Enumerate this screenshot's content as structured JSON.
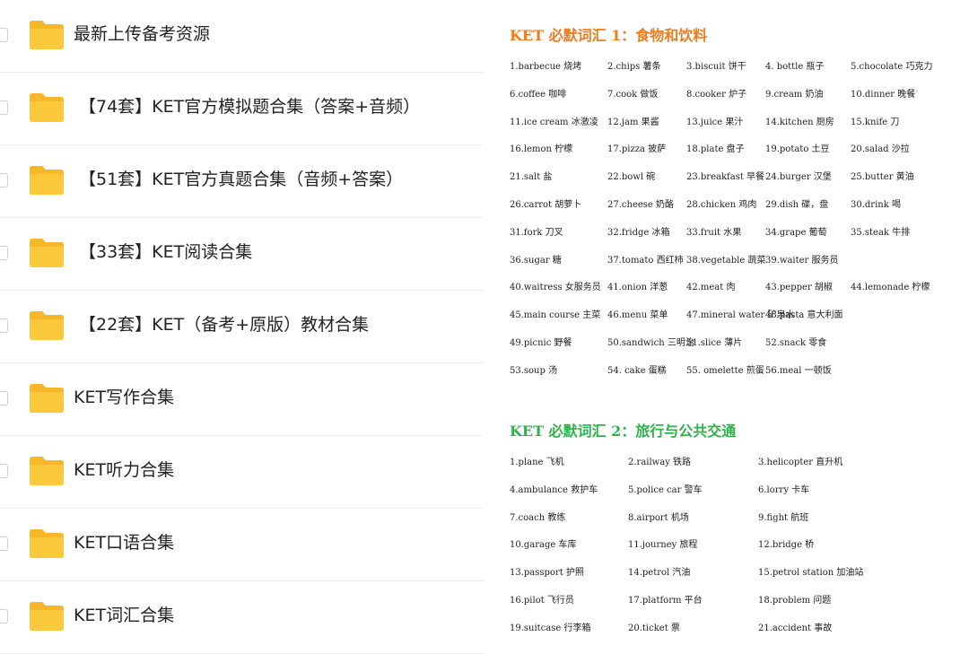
{
  "folders": [
    {
      "label": "最新上传备考资源"
    },
    {
      "label": "【74套】KET官方模拟题合集（答案+音频）"
    },
    {
      "label": "【51套】KET官方真题合集（音频+答案）"
    },
    {
      "label": "【33套】KET阅读合集"
    },
    {
      "label": "【22套】KET（备考+原版）教材合集"
    },
    {
      "label": "KET写作合集"
    },
    {
      "label": "KET听力合集"
    },
    {
      "label": "KET口语合集"
    },
    {
      "label": "KET词汇合集"
    }
  ],
  "vocab": {
    "section1_title": "KET 必默词汇 1：食物和饮料",
    "section2_title": "KET 必默词汇 2：旅行与公共交通",
    "section1": [
      [
        "1.barbecue 烧烤",
        "2.chips 薯条",
        "3.biscuit 饼干",
        "4. bottle 瓶子",
        "5.chocolate 巧克力"
      ],
      [
        "6.coffee 咖啡",
        "7.cook 做饭",
        "8.cooker 炉子",
        "9.cream 奶油",
        "10.dinner 晚餐"
      ],
      [
        "11.ice cream 冰激凌",
        "12.jam 果酱",
        "13.juice 果汁",
        "14.kitchen 厨房",
        "15.knife 刀"
      ],
      [
        "16.lemon 柠檬",
        "17.pizza 披萨",
        "18.plate 盘子",
        "19.potato 土豆",
        "20.salad 沙拉"
      ],
      [
        "21.salt 盐",
        "22.bowl 碗",
        "23.breakfast 早餐",
        "24.burger 汉堡",
        "25.butter 黄油"
      ],
      [
        "26.carrot 胡萝卜",
        "27.cheese 奶酪",
        "28.chicken 鸡肉",
        "29.dish 碟，盘",
        "30.drink 喝"
      ],
      [
        "31.fork 刀叉",
        "32.fridge 冰箱",
        "33.fruit 水果",
        "34.grape 葡萄",
        "35.steak 牛排"
      ],
      [
        "36.sugar 糖",
        "37.tomato 西红柿",
        "38.vegetable 蔬菜",
        "39.waiter 服务员"
      ],
      [
        "40.waitress 女服务员",
        "41.onion 洋葱",
        "42.meat 肉",
        "43.pepper 胡椒",
        "44.lemonade 柠檬"
      ],
      [
        "45.main course 主菜",
        "46.menu 菜单",
        "47.mineral water 矿泉水",
        "48.pasta 意大利面"
      ],
      [
        "49.picnic 野餐",
        "50.sandwich 三明治",
        "51.slice 薄片",
        "52.snack 零食"
      ],
      [
        "53.soup 汤",
        "54. cake 蛋糕",
        "55. omelette 煎蛋",
        "56.meal 一顿饭"
      ]
    ],
    "section2": [
      [
        "1.plane 飞机",
        "2.railway 铁路",
        "3.helicopter 直升机"
      ],
      [
        "4.ambulance 救护车",
        "5.police car 警车",
        "6.lorry 卡车"
      ],
      [
        "7.coach 教练",
        "8.airport 机场",
        "9.fight 航班"
      ],
      [
        "10.garage 车库",
        "11.journey 旅程",
        "12.bridge 桥"
      ],
      [
        "13.passport 护照",
        "14.petrol 汽油",
        "15.petrol station 加油站"
      ],
      [
        "16.pilot 飞行员",
        "17.platform 平台",
        "18.problem 问题"
      ],
      [
        "19.suitcase 行李箱",
        "20.ticket 票",
        "21.accident 事故"
      ]
    ]
  }
}
